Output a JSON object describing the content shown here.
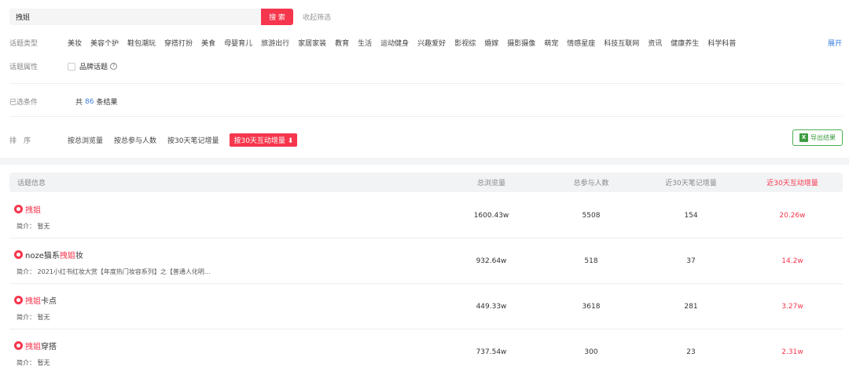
{
  "search": {
    "value": "拽姐",
    "button_label": "搜 索",
    "collapse_label": "收起筛选"
  },
  "topic_type": {
    "label": "话题类型",
    "categories": [
      "美妆",
      "美容个护",
      "鞋包潮玩",
      "穿搭打扮",
      "美食",
      "母婴育儿",
      "旅游出行",
      "家居家装",
      "教育",
      "生活",
      "运动健身",
      "兴趣爱好",
      "影视综",
      "婚嫁",
      "摄影摄像",
      "萌宠",
      "情感星座",
      "科技互联网",
      "资讯",
      "健康养生",
      "科学科普"
    ],
    "expand_label": "展开"
  },
  "topic_attr": {
    "label": "话题属性",
    "option": "品牌话题",
    "help": "?"
  },
  "selected": {
    "label": "已选条件",
    "prefix": "共",
    "count": "86",
    "suffix": "条结果"
  },
  "sort": {
    "label": "排　序",
    "options": [
      "按总浏览量",
      "按总参与人数",
      "按30天笔记增量"
    ],
    "active": "按30天互动增量 ⬇"
  },
  "export": {
    "icon": "X",
    "label": "导出结果"
  },
  "table": {
    "headers": {
      "topic": "话题信息",
      "views": "总浏览量",
      "participants": "总参与人数",
      "notes30": "近30天笔记增量",
      "interact30": "近30天互动增量"
    },
    "rows": [
      {
        "pre": "",
        "hl": "拽姐",
        "post": "",
        "desc": "简介：  暂无",
        "views": "1600.43w",
        "participants": "5508",
        "notes30": "154",
        "interact30": "20.26w"
      },
      {
        "pre": "noze猫系",
        "hl": "拽姐",
        "post": "妆",
        "desc": "简介：  2021小红书红妆大赏【年度热门妆容系列】之【普通人化明...",
        "views": "932.64w",
        "participants": "518",
        "notes30": "37",
        "interact30": "14.2w"
      },
      {
        "pre": "",
        "hl": "拽姐",
        "post": "卡点",
        "desc": "简介：  暂无",
        "views": "449.33w",
        "participants": "3618",
        "notes30": "281",
        "interact30": "3.27w"
      },
      {
        "pre": "",
        "hl": "拽姐",
        "post": "穿搭",
        "desc": "简介：  暂无",
        "views": "737.54w",
        "participants": "300",
        "notes30": "23",
        "interact30": "2.31w"
      }
    ]
  },
  "colors": {
    "accent": "#f5364d",
    "link": "#3a7ddf",
    "excel": "#3b9c3f"
  }
}
